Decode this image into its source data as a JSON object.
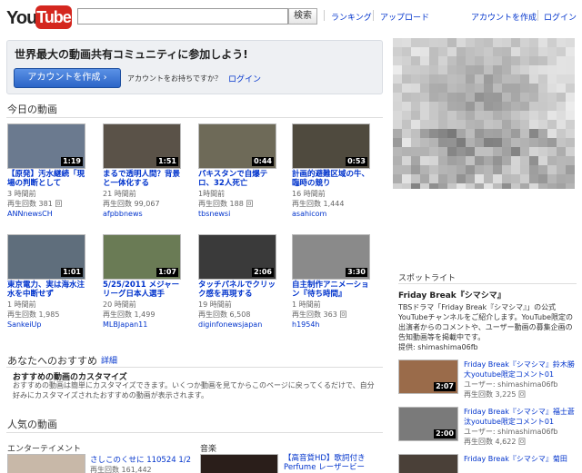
{
  "header": {
    "logo_you": "You",
    "logo_tube": "Tube",
    "search_placeholder": "",
    "search_button": "検索",
    "links": [
      "ランキング",
      "アップロード"
    ],
    "right_links": [
      "アカウントを作成",
      "ログイン"
    ]
  },
  "promo": {
    "title": "世界最大の動画共有コミュニティに参加しよう!",
    "create_button": "アカウントを作成 ›",
    "have_account": "アカウントをお持ちですか？",
    "login": "ログイン"
  },
  "today": {
    "title": "今日の動画",
    "videos": [
      {
        "title": "【原発】汚水継続「現場の判断として",
        "time": "3 時間前",
        "views": "再生回数 381 回",
        "channel": "ANNnewsCH",
        "duration": "1:19"
      },
      {
        "title": "まるで透明人間？背景と一体化する",
        "time": "21 時間前",
        "views": "再生回数 99,067",
        "channel": "afpbbnews",
        "duration": "1:51"
      },
      {
        "title": "パキスタンで自爆テロ、32人死亡",
        "time": "1時間前",
        "views": "再生回数 188 回",
        "channel": "tbsnewsi",
        "duration": "0:44"
      },
      {
        "title": "計画的避難区域の牛、臨時の競り",
        "time": "16 時間前",
        "views": "再生回数 1,444",
        "channel": "asahicom",
        "duration": "0:53"
      },
      {
        "title": "東京電力、実は海水注水を中断せず",
        "time": "1 時間前",
        "views": "再生回数 1,985",
        "channel": "SankeiUp",
        "duration": "1:01"
      },
      {
        "title": "5/25/2011 メジャーリーグ日本人選手",
        "time": "20 時間前",
        "views": "再生回数 1,499",
        "channel": "MLBJapan11",
        "duration": "1:07"
      },
      {
        "title": "タッチパネルでクリック感を再現する",
        "time": "19 時間前",
        "views": "再生回数 6,508",
        "channel": "diginfonewsjapan",
        "duration": "2:06"
      },
      {
        "title": "自主制作アニメーション『待ち時間』",
        "time": "1 時間前",
        "views": "再生回数 363 回",
        "channel": "h1954h",
        "duration": "3:30"
      }
    ]
  },
  "recommend": {
    "title": "あなたへのおすすめ",
    "detail_link": "詳細",
    "box_title": "おすすめの動画のカスタマイズ",
    "box_body": "おすすめの動画は簡単にカスタマイズできます。いくつか動画を見てからこのページに戻ってくるだけで、自分好みにカスタマイズされたおすすめの動画が表示されます。"
  },
  "popular": {
    "title": "人気の動画",
    "cat1": "エンターテイメント",
    "cat1_video_title": "さしこのくせに 110524 1/2",
    "cat1_video_views": "再生回数 161,442",
    "cat2": "音楽",
    "cat2_video_title": "【高音質HD】歌詞付き Perfume レーザービー"
  },
  "spotlight": {
    "title": "スポットライト",
    "name": "Friday Break『シマシマ』",
    "desc": "TBSドラマ「Friday Break『シマシマ』」の公式YouTubeチャンネルをご紹介します。YouTube限定の出演者からのコメントや、ユーザー動画の募集企画の告知動画等を掲載中です。",
    "provider": "提供: shimashima06fb",
    "videos": [
      {
        "title": "Friday Break『シマシマ』鈴木勝大youtube限定コメント01",
        "user": "ユーザー: shimashima06fb",
        "views": "再生回数 3,225 回",
        "duration": "2:07"
      },
      {
        "title": "Friday Break『シマシマ』福士蒼汰youtube限定コメント01",
        "user": "ユーザー: shimashima06fb",
        "views": "再生回数 4,622 回",
        "duration": "2:00"
      },
      {
        "title": "Friday Break『シマシマ』菊田",
        "user": "",
        "views": "",
        "duration": ""
      }
    ]
  },
  "colors": {
    "link": "#0033cc",
    "accent": "#d4271f",
    "button": "#2b64c7"
  }
}
